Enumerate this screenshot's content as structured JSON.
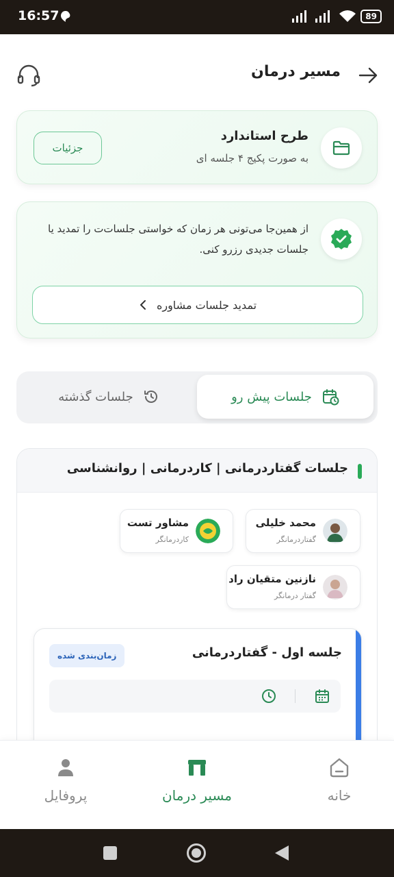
{
  "status_bar": {
    "time": "16:57",
    "battery": "89"
  },
  "header": {
    "title": "مسیر درمان"
  },
  "plan": {
    "title": "طرح استاندارد",
    "subtitle": "به صورت پکیج ۴ جلسه ای",
    "details_label": "جزئیات"
  },
  "info": {
    "text": "از همین‌جا می‌تونی هر زمان که خواستی جلسات‌ت را تمدید یا جلسات جدیدی رزرو کنی.",
    "extend_label": "تمدید جلسات مشاوره"
  },
  "tabs": {
    "upcoming": "جلسات پیش رو",
    "past": "جلسات گذشته"
  },
  "section": {
    "title": "جلسات گفتاردرمانی | کاردرمانی | روانشناسی",
    "therapists": [
      {
        "name": "محمد خلیلی",
        "role": "گفتاردرمانگر"
      },
      {
        "name": "مشاور تست",
        "role": "کاردرمانگر"
      },
      {
        "name": "نازنین متقیان راد",
        "role": "گفتار درمانگر"
      }
    ],
    "session": {
      "title": "جلسه اول - گفتاردرمانی",
      "status": "زمان‌بندی شده"
    }
  },
  "bottom_nav": {
    "home": "خانه",
    "path": "مسیر درمان",
    "profile": "پروفایل"
  },
  "colors": {
    "accent_green": "#2a8a55",
    "accent_blue": "#3b7de6"
  }
}
